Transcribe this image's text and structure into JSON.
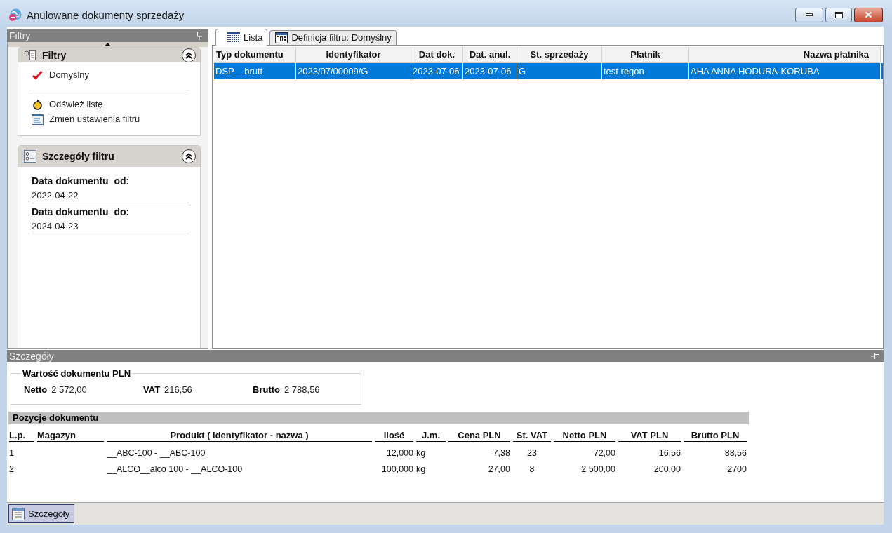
{
  "window": {
    "title": "Anulowane dokumenty sprzedaży"
  },
  "filter_pane": {
    "title": "Filtry",
    "filters": {
      "title": "Filtry",
      "expanded": true,
      "items": [
        {
          "label": "Domyślny",
          "selected": true
        }
      ],
      "actions": [
        {
          "kind": "refresh",
          "label": "Odśwież listę"
        },
        {
          "kind": "edit",
          "label": "Zmień ustawienia filtru"
        }
      ]
    },
    "details": {
      "title": "Szczegóły filtru",
      "expanded": true,
      "fields": [
        {
          "label": "Data dokumentu  od:",
          "value": "2022-04-22"
        },
        {
          "label": "Data dokumentu  do:",
          "value": "2024-04-23"
        }
      ]
    }
  },
  "tabs": [
    {
      "kind": "list",
      "label": "Lista",
      "selected": true
    },
    {
      "kind": "definition",
      "label": "Definicja filtru: Domyślny",
      "selected": false
    }
  ],
  "table": {
    "columns": [
      "Typ dokumentu",
      "Identyfikator",
      "Dat dok.",
      "Dat. anul.",
      "St. sprzedaży",
      "Płatnik",
      "Nazwa płatnika"
    ],
    "rows": [
      {
        "selected": true,
        "cells": [
          "DSP__brutt",
          "2023/07/00009/G",
          "2023-07-06",
          "2023-07-06",
          "G",
          "test regon",
          "AHA ANNA HODURA-KORUBA"
        ]
      }
    ]
  },
  "details_pane": {
    "title": "Szczegóły",
    "totals": {
      "title": "Wartość dokumentu PLN",
      "items": [
        {
          "label": "Netto",
          "value": "2 572,00"
        },
        {
          "label": "VAT",
          "value": "216,56"
        },
        {
          "label": "Brutto",
          "value": "2 788,56"
        }
      ]
    },
    "positions": {
      "title": "Pozycje dokumentu",
      "columns": [
        "L.p.",
        "Magazyn",
        "Produkt ( identyfikator - nazwa )",
        "Ilość",
        "J.m.",
        "Cena PLN",
        "St. VAT",
        "Netto PLN",
        "VAT PLN",
        "Brutto PLN"
      ],
      "rows": [
        {
          "lp": "1",
          "product": "__ABC-100 - __ABC-100",
          "quantity": "12,000",
          "unit": "kg",
          "price": "7,38",
          "vat_rate": "23",
          "net": "72,00",
          "vat": "16,56",
          "gross": "88,56"
        },
        {
          "lp": "2",
          "product": "__ALCO__alco 100 - __ALCO-100",
          "quantity": "100,000",
          "unit": "kg",
          "price": "27,00",
          "vat_rate": "8",
          "net": "2 500,00",
          "vat": "200,00",
          "gross": "2700"
        }
      ]
    }
  },
  "bottom_bar": {
    "buttons": [
      {
        "label": "Szczegóły",
        "selected": true
      }
    ]
  }
}
